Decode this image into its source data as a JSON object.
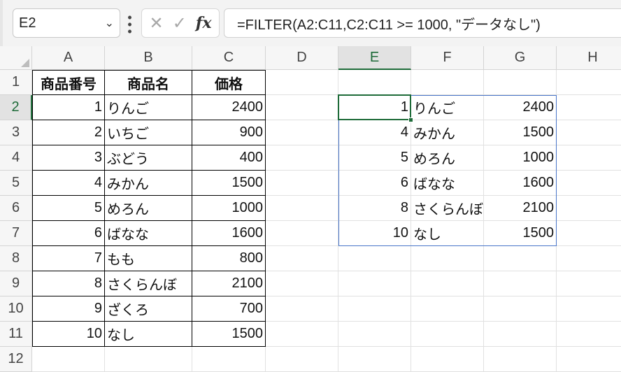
{
  "name_box": "E2",
  "formula": "=FILTER(A2:C11,C2:C11 >= 1000, \"データなし\")",
  "fx_label": "fx",
  "columns": [
    "A",
    "B",
    "C",
    "D",
    "E",
    "F",
    "G",
    "H"
  ],
  "rows": [
    "1",
    "2",
    "3",
    "4",
    "5",
    "6",
    "7",
    "8",
    "9",
    "10",
    "11",
    "12"
  ],
  "headers": [
    "商品番号",
    "商品名",
    "価格"
  ],
  "data": [
    [
      "1",
      "りんご",
      "2400"
    ],
    [
      "2",
      "いちご",
      "900"
    ],
    [
      "3",
      "ぶどう",
      "400"
    ],
    [
      "4",
      "みかん",
      "1500"
    ],
    [
      "5",
      "めろん",
      "1000"
    ],
    [
      "6",
      "ばなな",
      "1600"
    ],
    [
      "7",
      "もも",
      "800"
    ],
    [
      "8",
      "さくらんぼ",
      "2100"
    ],
    [
      "9",
      "ざくろ",
      "700"
    ],
    [
      "10",
      "なし",
      "1500"
    ]
  ],
  "result": [
    [
      "1",
      "りんご",
      "2400"
    ],
    [
      "4",
      "みかん",
      "1500"
    ],
    [
      "5",
      "めろん",
      "1000"
    ],
    [
      "6",
      "ばなな",
      "1600"
    ],
    [
      "8",
      "さくらんぼ",
      "2100"
    ],
    [
      "10",
      "なし",
      "1500"
    ]
  ],
  "colors": {
    "selection": "#1e6b39",
    "spill_border": "#4a76c9"
  }
}
